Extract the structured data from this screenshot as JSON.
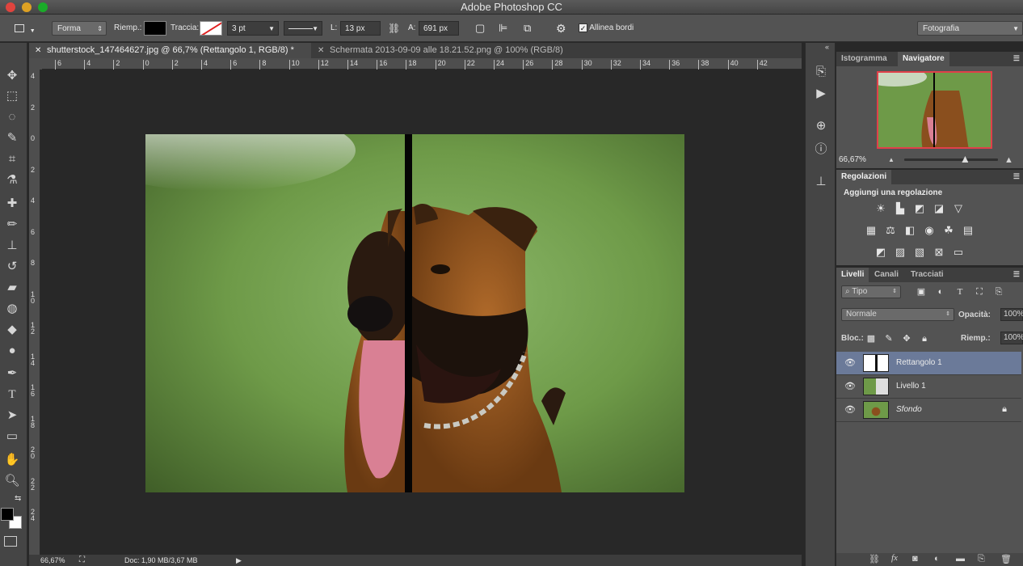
{
  "window": {
    "title": "Adobe Photoshop CC"
  },
  "options_bar": {
    "mode": "Forma",
    "fill_label": "Riemp.:",
    "stroke_label": "Traccia:",
    "stroke_width": "3 pt",
    "w_label": "L:",
    "w_value": "13 px",
    "h_label": "A:",
    "h_value": "691 px",
    "align_edges_label": "Allinea bordi",
    "align_edges_checked": true,
    "workspace": "Fotografia"
  },
  "tabs": [
    {
      "label": "shutterstock_147464627.jpg @ 66,7% (Rettangolo 1, RGB/8) *",
      "active": true
    },
    {
      "label": "Schermata 2013-09-09 alle 18.21.52.png @ 100% (RGB/8)",
      "active": false
    }
  ],
  "ruler": {
    "h_ticks": [
      "6",
      "4",
      "2",
      "0",
      "2",
      "4",
      "6",
      "8",
      "10",
      "12",
      "14",
      "16",
      "18",
      "20",
      "22",
      "24",
      "26",
      "28",
      "30",
      "32",
      "34",
      "36",
      "38",
      "40",
      "42"
    ],
    "v_ticks": [
      "4",
      "2",
      "0",
      "2",
      "4",
      "6",
      "8",
      "1\n0",
      "1\n2",
      "1\n4",
      "1\n6",
      "1\n8",
      "2\n0",
      "2\n2",
      "2\n4"
    ]
  },
  "status": {
    "zoom": "66,67%",
    "doc": "Doc: 1,90 MB/3,67 MB"
  },
  "navigator": {
    "tabs": [
      "Istogramma",
      "Navigatore"
    ],
    "active_tab": "Navigatore",
    "zoom": "66,67%",
    "zoom_slider_fraction": 0.65
  },
  "adjustments": {
    "tab": "Regolazioni",
    "heading": "Aggiungi una regolazione"
  },
  "layers_panel": {
    "tabs": [
      "Livelli",
      "Canali",
      "Tracciati"
    ],
    "active_tab": "Livelli",
    "filter": "Tipo",
    "blend_mode": "Normale",
    "opacity_label": "Opacità:",
    "opacity": "100%",
    "lock_label": "Bloc.:",
    "fill_label": "Riemp.:",
    "fill": "100%",
    "layers": [
      {
        "name": "Rettangolo 1",
        "selected": true,
        "italic": false,
        "locked": false
      },
      {
        "name": "Livello 1",
        "selected": false,
        "italic": false,
        "locked": false
      },
      {
        "name": "Sfondo",
        "selected": false,
        "italic": true,
        "locked": true
      }
    ]
  },
  "colors": {
    "accent_selection": "#6b7a99",
    "navigator_frame": "#e0404a"
  }
}
